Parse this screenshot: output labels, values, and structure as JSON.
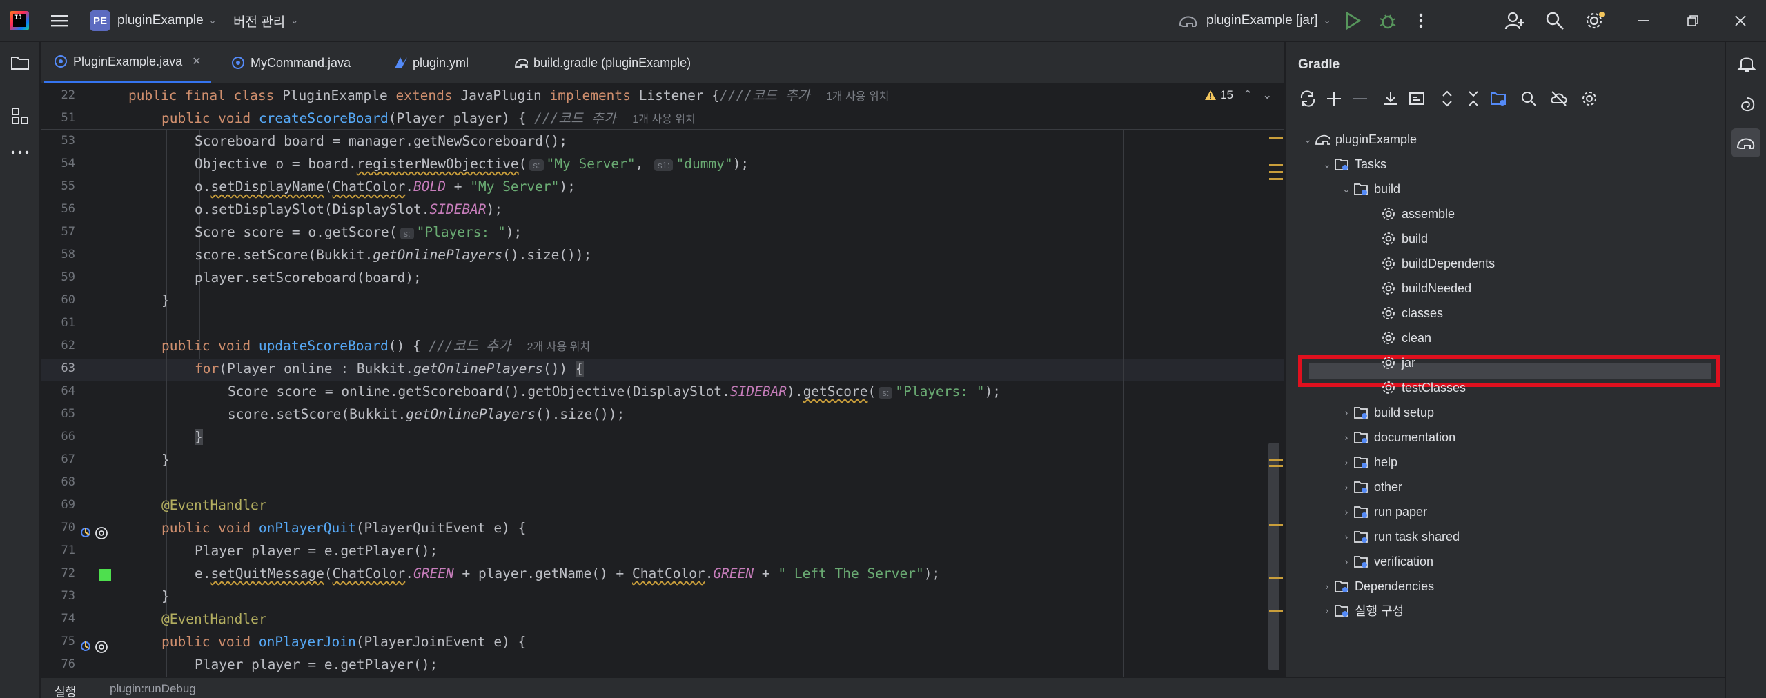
{
  "titlebar": {
    "project_badge": "PE",
    "project_name": "pluginExample",
    "vcs_menu": "버전 관리",
    "run_config": "pluginExample [jar]"
  },
  "tabs": [
    {
      "label": "PluginExample.java",
      "active": true
    },
    {
      "label": "MyCommand.java"
    },
    {
      "label": "plugin.yml"
    },
    {
      "label": "build.gradle (pluginExample)"
    }
  ],
  "editor": {
    "warning_count": "15",
    "sticky": [
      {
        "line": "22",
        "hint": "1개 사용 위치"
      },
      {
        "line": "51",
        "hint": "1개 사용 위치"
      }
    ],
    "line_numbers": [
      "53",
      "54",
      "55",
      "56",
      "57",
      "58",
      "59",
      "60",
      "61",
      "62",
      "63",
      "64",
      "65",
      "66",
      "67",
      "68",
      "69",
      "70",
      "71",
      "72",
      "73",
      "74",
      "75",
      "76"
    ],
    "hints": {
      "update_usage": "2개 사용 위치",
      "code_comment": "///코드 추가",
      "class_comment": "////코드 추가"
    },
    "strings": {
      "my_server": "\"My Server\"",
      "dummy": "\"dummy\"",
      "players": "\"Players: \"",
      "left_server": "\" Left The Server\""
    },
    "param_hints": {
      "s": "s:",
      "s1": "s1:"
    }
  },
  "gradle": {
    "title": "Gradle",
    "root": "pluginExample",
    "tasks_label": "Tasks",
    "build_group": "build",
    "build_tasks": [
      "assemble",
      "build",
      "buildDependents",
      "buildNeeded",
      "classes",
      "clean",
      "jar",
      "testClasses"
    ],
    "selected_task": "jar",
    "groups": [
      "build setup",
      "documentation",
      "help",
      "other",
      "run paper",
      "run task shared",
      "verification"
    ],
    "dependencies": "Dependencies",
    "run_configs": "실행 구성"
  },
  "bottom": {
    "tab1": "실행",
    "tab2": "plugin:runDebug"
  },
  "colors": {
    "accent": "#3574f0",
    "highlight_box": "#e0101e",
    "keyword": "#cf8e6d",
    "function": "#56a8f5",
    "string": "#6aab73"
  }
}
